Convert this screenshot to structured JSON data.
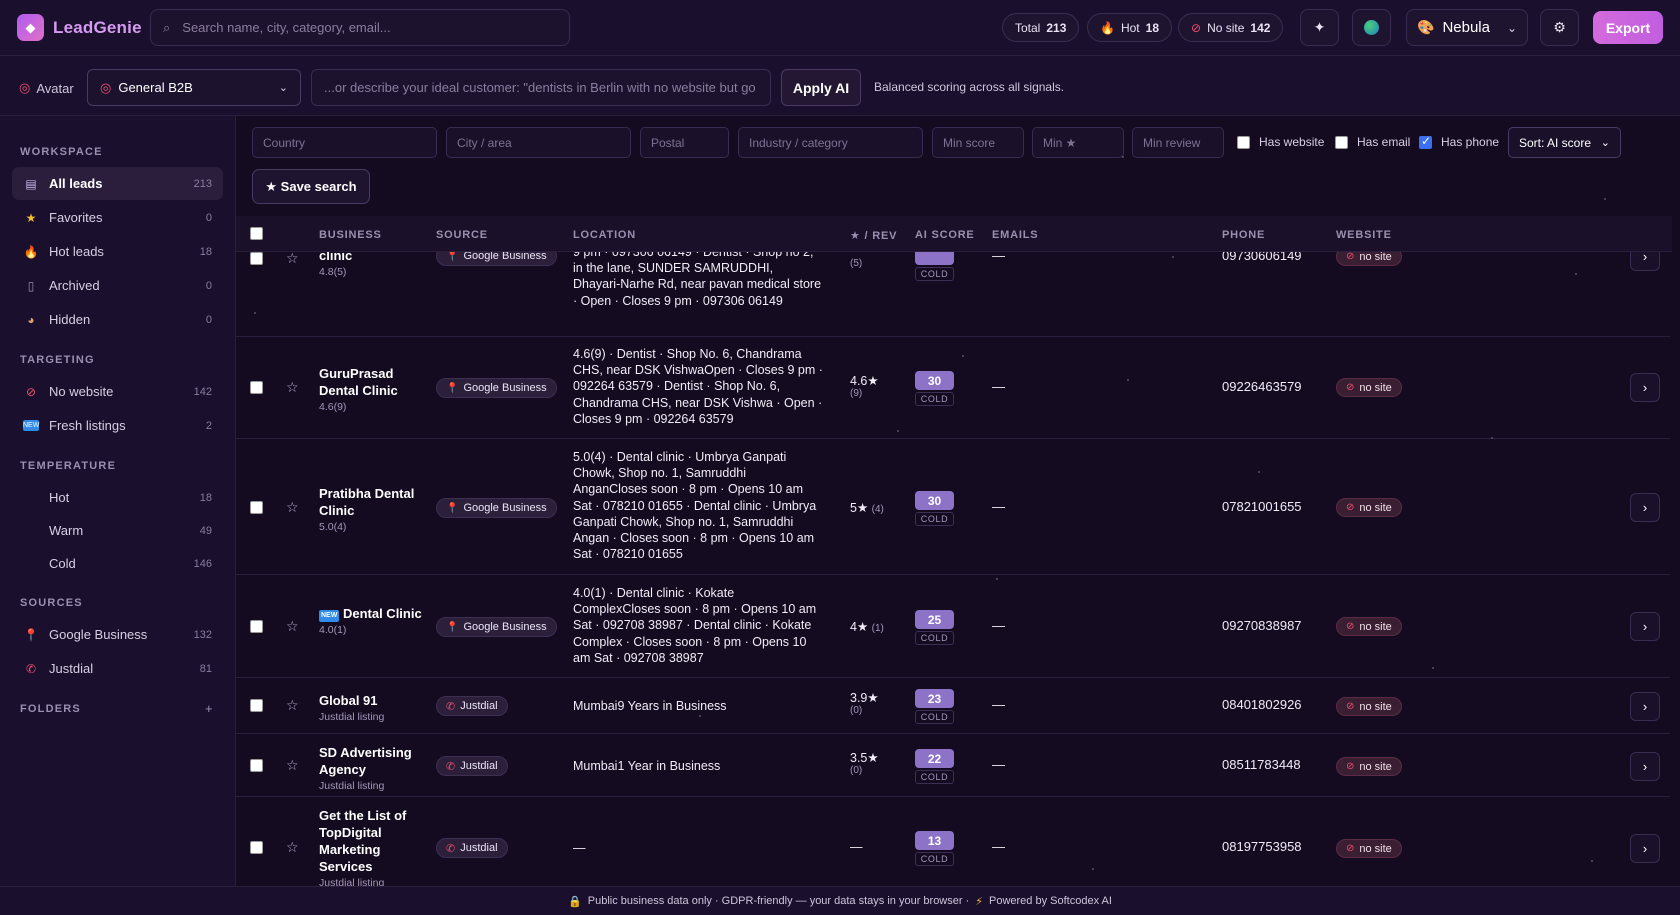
{
  "app": {
    "name": "LeadGenie"
  },
  "header": {
    "search_placeholder": "Search name, city, category, email...",
    "stats": [
      {
        "label": "Total",
        "value": "213"
      },
      {
        "label": "Hot",
        "value": "18"
      },
      {
        "label": "No site",
        "value": "142"
      }
    ],
    "theme": "Nebula",
    "export_label": "Export"
  },
  "avatar_bar": {
    "label": "Avatar",
    "selected": "General B2B",
    "ideal_placeholder": "...or describe your ideal customer: \"dentists in Berlin with no website but go",
    "apply_label": "Apply AI",
    "note": "Balanced scoring across all signals."
  },
  "sidebar": {
    "workspace_title": "WORKSPACE",
    "workspace": [
      {
        "label": "All leads",
        "count": "213"
      },
      {
        "label": "Favorites",
        "count": "0"
      },
      {
        "label": "Hot leads",
        "count": "18"
      },
      {
        "label": "Archived",
        "count": "0"
      },
      {
        "label": "Hidden",
        "count": "0"
      }
    ],
    "targeting_title": "TARGETING",
    "targeting": [
      {
        "label": "No website",
        "count": "142"
      },
      {
        "label": "Fresh listings",
        "count": "2"
      }
    ],
    "temperature_title": "TEMPERATURE",
    "temperature": [
      {
        "label": "Hot",
        "count": "18"
      },
      {
        "label": "Warm",
        "count": "49"
      },
      {
        "label": "Cold",
        "count": "146"
      }
    ],
    "sources_title": "SOURCES",
    "sources": [
      {
        "label": "Google Business",
        "count": "132"
      },
      {
        "label": "Justdial",
        "count": "81"
      }
    ],
    "folders_title": "FOLDERS",
    "folders_add": "+"
  },
  "filters": {
    "country": "Country",
    "city": "City / area",
    "postal": "Postal",
    "industry": "Industry / category",
    "min_score": "Min score",
    "min_star": "Min ★",
    "min_review": "Min review",
    "has_website": "Has website",
    "has_email": "Has email",
    "has_phone": "Has phone",
    "sort": "Sort: AI score",
    "save_search": "★ Save search"
  },
  "table": {
    "columns": [
      "BUSINESS",
      "SOURCE",
      "LOCATION",
      "★ / REV",
      "AI SCORE",
      "EMAILS",
      "PHONE",
      "WEBSITE"
    ],
    "rows": [
      {
        "name": "clinic",
        "sub": "4.8(5)",
        "source": "Google Business",
        "location": "9 pm · 097306 06149 · Dentist · Shop no 2, in the lane, SUNDER SAMRUDDHI, Dhayari-Narhe Rd, near pavan medical store · Open · Closes 9 pm · 097306 06149",
        "rating": "",
        "reviews": "(5)",
        "score": "",
        "temp": "COLD",
        "emails": "—",
        "phone": "09730606149",
        "website": "no site"
      },
      {
        "name": "GuruPrasad Dental Clinic",
        "sub": "4.6(9)",
        "source": "Google Business",
        "location": "4.6(9) · Dentist · Shop No. 6, Chandrama CHS, near DSK VishwaOpen · Closes 9 pm · 092264 63579 · Dentist · Shop No. 6, Chandrama CHS, near DSK Vishwa · Open · Closes 9 pm · 092264 63579",
        "rating": "4.6★",
        "reviews": "(9)",
        "score": "30",
        "temp": "COLD",
        "emails": "—",
        "phone": "09226463579",
        "website": "no site"
      },
      {
        "name": "Pratibha Dental Clinic",
        "sub": "5.0(4)",
        "source": "Google Business",
        "location": "5.0(4) · Dental clinic · Umbrya Ganpati Chowk, Shop no. 1, Samruddhi AnganCloses soon · 8 pm · Opens 10 am Sat · 078210 01655 · Dental clinic · Umbrya Ganpati Chowk, Shop no. 1, Samruddhi Angan · Closes soon · 8 pm · Opens 10 am Sat · 078210 01655",
        "rating": "5★",
        "reviews": "(4)",
        "score": "30",
        "temp": "COLD",
        "emails": "—",
        "phone": "07821001655",
        "website": "no site"
      },
      {
        "name": "Dental Clinic",
        "badge": "NEW",
        "sub": "4.0(1)",
        "source": "Google Business",
        "location": "4.0(1) · Dental clinic · Kokate ComplexCloses soon · 8 pm · Opens 10 am Sat · 092708 38987 · Dental clinic · Kokate Complex · Closes soon · 8 pm · Opens 10 am Sat · 092708 38987",
        "rating": "4★",
        "reviews": "(1)",
        "score": "25",
        "temp": "COLD",
        "emails": "—",
        "phone": "09270838987",
        "website": "no site"
      },
      {
        "name": "Global 91",
        "sub": "Justdial listing",
        "source": "Justdial",
        "location": "Mumbai9 Years in Business",
        "rating": "3.9★",
        "reviews": "(0)",
        "score": "23",
        "temp": "COLD",
        "emails": "—",
        "phone": "08401802926",
        "website": "no site"
      },
      {
        "name": "SD Advertising Agency",
        "sub": "Justdial listing",
        "source": "Justdial",
        "location": "Mumbai1 Year in Business",
        "rating": "3.5★",
        "reviews": "(0)",
        "score": "22",
        "temp": "COLD",
        "emails": "—",
        "phone": "08511783448",
        "website": "no site"
      },
      {
        "name": "Get the List of TopDigital Marketing Services",
        "sub": "Justdial listing",
        "source": "Justdial",
        "location": "—",
        "rating": "—",
        "reviews": "",
        "score": "13",
        "temp": "COLD",
        "emails": "—",
        "phone": "08197753958",
        "website": "no site"
      }
    ]
  },
  "footer": {
    "text": "Public business data only · GDPR-friendly — your data stays in your browser ·",
    "powered": "Powered by Softcodex AI"
  }
}
